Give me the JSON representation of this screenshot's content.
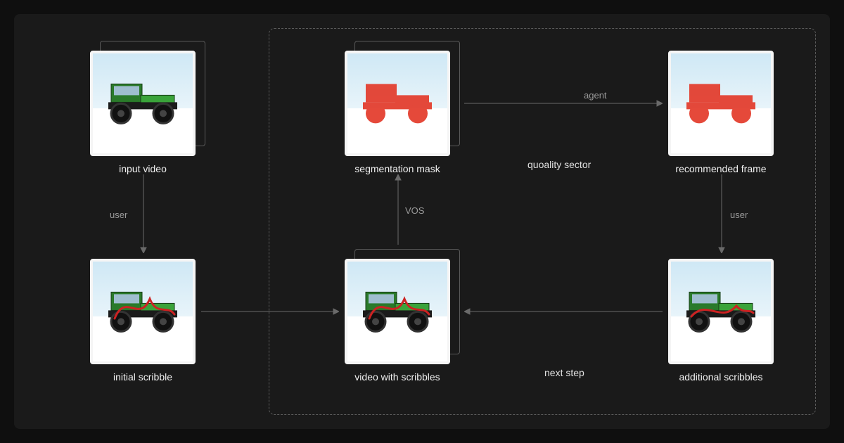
{
  "nodes": {
    "input_video": {
      "caption": "input video"
    },
    "initial_scribble": {
      "caption": "initial scribble"
    },
    "segmentation_mask": {
      "caption": "segmentation mask"
    },
    "video_with_scribbles": {
      "caption": "video with scribbles"
    },
    "recommended_frame": {
      "caption": "recommended frame"
    },
    "additional_scribbles": {
      "caption": "additional scribbles"
    }
  },
  "edges": {
    "user_top": "user",
    "user_right": "user",
    "agent": "agent",
    "vos": "VOS",
    "quality_sector": "quoality sector",
    "next_step": "next step"
  }
}
